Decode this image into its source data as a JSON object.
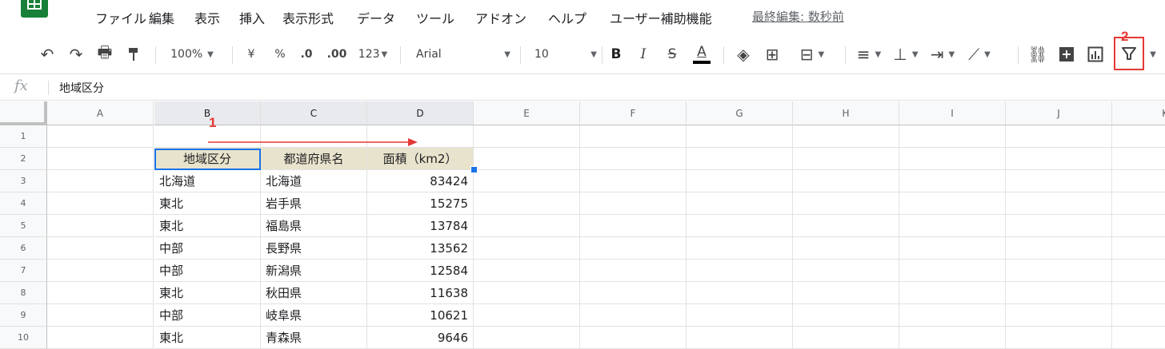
{
  "menu": {
    "items": [
      "ファイル",
      "編集",
      "表示",
      "挿入",
      "表示形式",
      "データ",
      "ツール",
      "アドオン",
      "ヘルプ",
      "ユーザー補助機能"
    ],
    "last_edit": "最終編集: 数秒前"
  },
  "toolbar": {
    "zoom": "100%",
    "currency": "¥",
    "percent": "%",
    "decimal_decrease": ".0",
    "decimal_increase": ".00",
    "format_more": "123",
    "font": "Arial",
    "font_size": "10",
    "bold": "B",
    "italic": "I",
    "strike": "S",
    "text_color": "A",
    "filter_highlight_color": "#e53935"
  },
  "annotations": {
    "label_1": "1",
    "label_2": "2"
  },
  "formula_bar": {
    "fx": "fx",
    "value": "地域区分"
  },
  "columns": [
    "A",
    "B",
    "C",
    "D",
    "E",
    "F",
    "G",
    "H",
    "I",
    "J",
    "K"
  ],
  "rows": [
    "1",
    "2",
    "3",
    "4",
    "5",
    "6",
    "7",
    "8",
    "9",
    "10"
  ],
  "table": {
    "headers": [
      "地域区分",
      "都道府県名",
      "面積（km2）"
    ],
    "rows": [
      [
        "北海道",
        "北海道",
        "83424"
      ],
      [
        "東北",
        "岩手県",
        "15275"
      ],
      [
        "東北",
        "福島県",
        "13784"
      ],
      [
        "中部",
        "長野県",
        "13562"
      ],
      [
        "中部",
        "新潟県",
        "12584"
      ],
      [
        "東北",
        "秋田県",
        "11638"
      ],
      [
        "中部",
        "岐阜県",
        "10621"
      ],
      [
        "東北",
        "青森県",
        "9646"
      ]
    ]
  },
  "colors": {
    "header_fill": "#e8e3cc",
    "selection": "#1a73e8",
    "annotation": "#e53935",
    "brand": "#188038"
  }
}
